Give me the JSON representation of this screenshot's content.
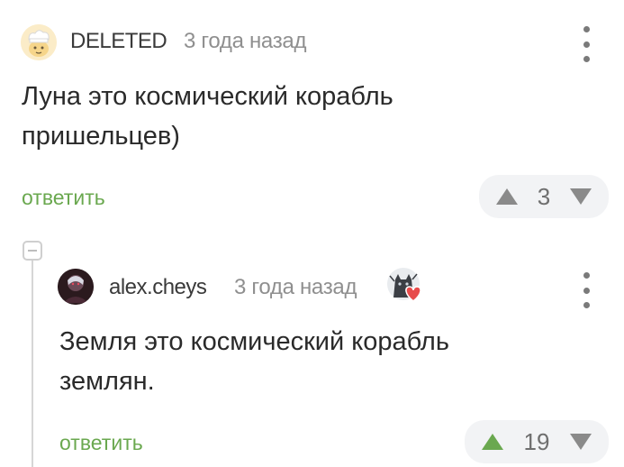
{
  "comment": {
    "username": "DELETED",
    "time": "3 года назад",
    "text_line1": "Луна это космический корабль",
    "text_line2": "пришельцев)",
    "reply_label": "ответить",
    "rating": "3"
  },
  "reply_comment": {
    "username": "alex.cheys",
    "time": "3 года назад",
    "text_line1": "Земля это космический корабль",
    "text_line2": "землян.",
    "reply_label": "ответить",
    "rating": "19"
  },
  "colors": {
    "reply_green": "#6aa84f",
    "upvote_active": "#6aa84f",
    "vote_inactive": "#8a8a8a",
    "vote_bg": "#f2f3f5"
  },
  "icons": {
    "comment_avatar": "chef-hat-avatar-icon",
    "reply_avatar": "user-photo-avatar",
    "badge": "cat-with-heart-icon",
    "menu": "vertical-dots-icon",
    "upvote": "triangle-up-icon",
    "downvote": "triangle-down-icon",
    "collapse": "minus-box-icon"
  }
}
